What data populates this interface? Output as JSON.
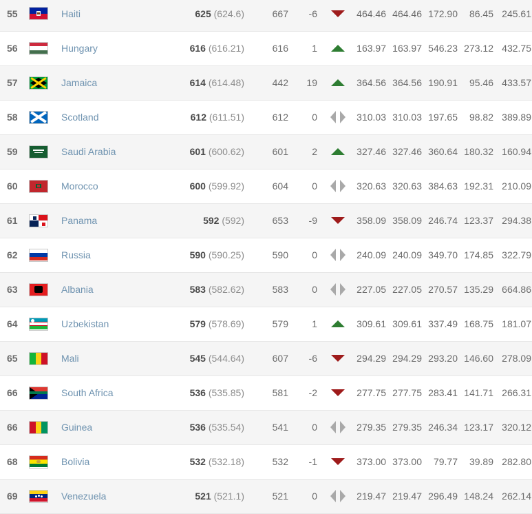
{
  "table": {
    "columns": [
      "rank",
      "flag",
      "team",
      "points",
      "previous_points",
      "rank_change",
      "change_indicator",
      "stat1",
      "stat2",
      "stat3",
      "stat4",
      "stat5"
    ],
    "indicator_labels": {
      "up": "up-arrow-icon",
      "down": "down-arrow-icon",
      "same": "no-change-icon"
    },
    "colors": {
      "up": "#2e7d32",
      "down": "#9e1b1b",
      "same": "#a9a9a9",
      "link": "#6f93b0",
      "rank": "#3d3d3d",
      "row_stripe": "#f5f5f5",
      "row_plain": "#ffffff"
    },
    "rows": [
      {
        "rank": "55",
        "team": "Haiti",
        "flag": "haiti-flag",
        "points": "625",
        "points_exact": "(624.6)",
        "previous_points": "667",
        "change": "-6",
        "indicator": "down",
        "stat1": "464.46",
        "stat2": "464.46",
        "stat3": "172.90",
        "stat4": "86.45",
        "stat5": "245.61"
      },
      {
        "rank": "56",
        "team": "Hungary",
        "flag": "hungary-flag",
        "points": "616",
        "points_exact": "(616.21)",
        "previous_points": "616",
        "change": "1",
        "indicator": "up",
        "stat1": "163.97",
        "stat2": "163.97",
        "stat3": "546.23",
        "stat4": "273.12",
        "stat5": "432.75"
      },
      {
        "rank": "57",
        "team": "Jamaica",
        "flag": "jamaica-flag",
        "points": "614",
        "points_exact": "(614.48)",
        "previous_points": "442",
        "change": "19",
        "indicator": "up",
        "stat1": "364.56",
        "stat2": "364.56",
        "stat3": "190.91",
        "stat4": "95.46",
        "stat5": "433.57"
      },
      {
        "rank": "58",
        "team": "Scotland",
        "flag": "scotland-flag",
        "points": "612",
        "points_exact": "(611.51)",
        "previous_points": "612",
        "change": "0",
        "indicator": "same",
        "stat1": "310.03",
        "stat2": "310.03",
        "stat3": "197.65",
        "stat4": "98.82",
        "stat5": "389.89"
      },
      {
        "rank": "59",
        "team": "Saudi Arabia",
        "flag": "saudi-arabia-flag",
        "points": "601",
        "points_exact": "(600.62)",
        "previous_points": "601",
        "change": "2",
        "indicator": "up",
        "stat1": "327.46",
        "stat2": "327.46",
        "stat3": "360.64",
        "stat4": "180.32",
        "stat5": "160.94"
      },
      {
        "rank": "60",
        "team": "Morocco",
        "flag": "morocco-flag",
        "points": "600",
        "points_exact": "(599.92)",
        "previous_points": "604",
        "change": "0",
        "indicator": "same",
        "stat1": "320.63",
        "stat2": "320.63",
        "stat3": "384.63",
        "stat4": "192.31",
        "stat5": "210.09"
      },
      {
        "rank": "61",
        "team": "Panama",
        "flag": "panama-flag",
        "points": "592",
        "points_exact": "(592)",
        "previous_points": "653",
        "change": "-9",
        "indicator": "down",
        "stat1": "358.09",
        "stat2": "358.09",
        "stat3": "246.74",
        "stat4": "123.37",
        "stat5": "294.38"
      },
      {
        "rank": "62",
        "team": "Russia",
        "flag": "russia-flag",
        "points": "590",
        "points_exact": "(590.25)",
        "previous_points": "590",
        "change": "0",
        "indicator": "same",
        "stat1": "240.09",
        "stat2": "240.09",
        "stat3": "349.70",
        "stat4": "174.85",
        "stat5": "322.79"
      },
      {
        "rank": "63",
        "team": "Albania",
        "flag": "albania-flag",
        "points": "583",
        "points_exact": "(582.62)",
        "previous_points": "583",
        "change": "0",
        "indicator": "same",
        "stat1": "227.05",
        "stat2": "227.05",
        "stat3": "270.57",
        "stat4": "135.29",
        "stat5": "664.86"
      },
      {
        "rank": "64",
        "team": "Uzbekistan",
        "flag": "uzbekistan-flag",
        "points": "579",
        "points_exact": "(578.69)",
        "previous_points": "579",
        "change": "1",
        "indicator": "up",
        "stat1": "309.61",
        "stat2": "309.61",
        "stat3": "337.49",
        "stat4": "168.75",
        "stat5": "181.07"
      },
      {
        "rank": "65",
        "team": "Mali",
        "flag": "mali-flag",
        "points": "545",
        "points_exact": "(544.64)",
        "previous_points": "607",
        "change": "-6",
        "indicator": "down",
        "stat1": "294.29",
        "stat2": "294.29",
        "stat3": "293.20",
        "stat4": "146.60",
        "stat5": "278.09"
      },
      {
        "rank": "66",
        "team": "South Africa",
        "flag": "south-africa-flag",
        "points": "536",
        "points_exact": "(535.85)",
        "previous_points": "581",
        "change": "-2",
        "indicator": "down",
        "stat1": "277.75",
        "stat2": "277.75",
        "stat3": "283.41",
        "stat4": "141.71",
        "stat5": "266.31"
      },
      {
        "rank": "66",
        "team": "Guinea",
        "flag": "guinea-flag",
        "points": "536",
        "points_exact": "(535.54)",
        "previous_points": "541",
        "change": "0",
        "indicator": "same",
        "stat1": "279.35",
        "stat2": "279.35",
        "stat3": "246.34",
        "stat4": "123.17",
        "stat5": "320.12"
      },
      {
        "rank": "68",
        "team": "Bolivia",
        "flag": "bolivia-flag",
        "points": "532",
        "points_exact": "(532.18)",
        "previous_points": "532",
        "change": "-1",
        "indicator": "down",
        "stat1": "373.00",
        "stat2": "373.00",
        "stat3": "79.77",
        "stat4": "39.89",
        "stat5": "282.80"
      },
      {
        "rank": "69",
        "team": "Venezuela",
        "flag": "venezuela-flag",
        "points": "521",
        "points_exact": "(521.1)",
        "previous_points": "521",
        "change": "0",
        "indicator": "same",
        "stat1": "219.47",
        "stat2": "219.47",
        "stat3": "296.49",
        "stat4": "148.24",
        "stat5": "262.14"
      }
    ]
  }
}
